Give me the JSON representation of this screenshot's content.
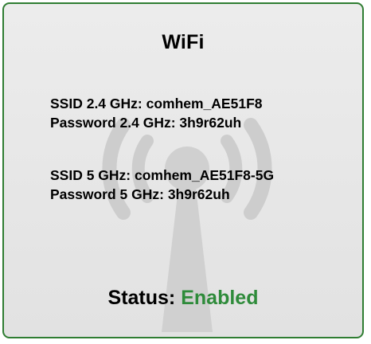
{
  "panel": {
    "title": "WiFi",
    "watermark_icon": "wifi-antenna-icon",
    "accent_color": "#2f7d32",
    "networks": [
      {
        "ssid_label": "SSID 2.4 GHz: ",
        "ssid_value": "comhem_AE51F8",
        "password_label": "Password 2.4 GHz: ",
        "password_value": "3h9r62uh"
      },
      {
        "ssid_label": "SSID 5 GHz: ",
        "ssid_value": "comhem_AE51F8-5G",
        "password_label": "Password 5 GHz: ",
        "password_value": "3h9r62uh"
      }
    ],
    "status_label": "Status: ",
    "status_value": "Enabled",
    "status_color": "#2e8b3a"
  }
}
